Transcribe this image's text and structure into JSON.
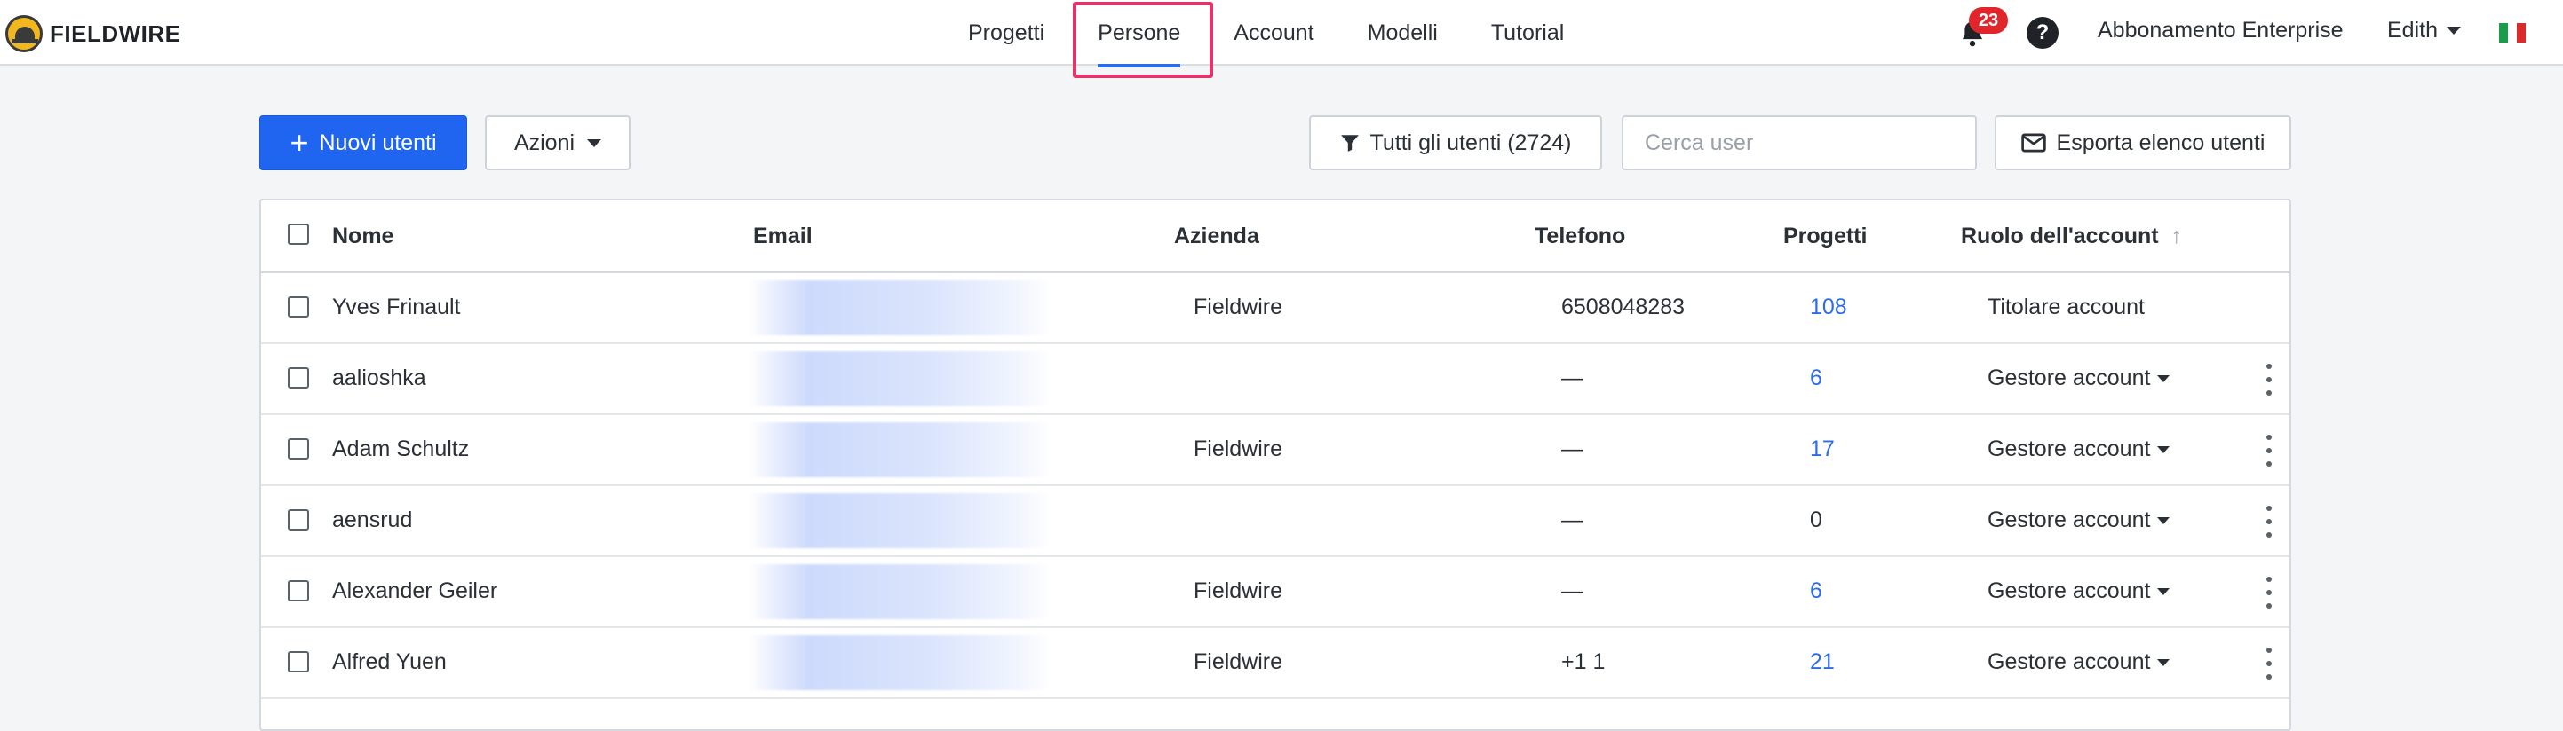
{
  "app": {
    "logo_text": "FIELDWIRE"
  },
  "nav": {
    "tabs": [
      {
        "label": "Progetti"
      },
      {
        "label": "Persone"
      },
      {
        "label": "Account"
      },
      {
        "label": "Modelli"
      },
      {
        "label": "Tutorial"
      }
    ],
    "active_tab": "Persone",
    "notification_count": "23",
    "help_label": "?",
    "plan_label": "Abbonamento Enterprise",
    "user_name": "Edith"
  },
  "toolbar": {
    "new_users_label": "Nuovi utenti",
    "actions_label": "Azioni",
    "filter_label": "Tutti gli utenti (2724)",
    "search_placeholder": "Cerca user",
    "export_label": "Esporta elenco utenti"
  },
  "table": {
    "columns": {
      "name": "Nome",
      "email": "Email",
      "company": "Azienda",
      "phone": "Telefono",
      "projects": "Progetti",
      "role": "Ruolo dell'account"
    },
    "rows": [
      {
        "name": "Yves Frinault",
        "company": "Fieldwire",
        "phone": "6508048283",
        "projects": "108",
        "role": "Titolare account"
      },
      {
        "name": "aalioshka",
        "company": "",
        "phone": "—",
        "projects": "6",
        "role": "Gestore account"
      },
      {
        "name": "Adam Schultz",
        "company": "Fieldwire",
        "phone": "—",
        "projects": "17",
        "role": "Gestore account"
      },
      {
        "name": "aensrud",
        "company": "",
        "phone": "—",
        "projects": "0",
        "role": "Gestore account"
      },
      {
        "name": "Alexander Geiler",
        "company": "Fieldwire",
        "phone": "—",
        "projects": "6",
        "role": "Gestore account"
      },
      {
        "name": "Alfred Yuen",
        "company": "Fieldwire",
        "phone": "+1 1",
        "projects": "21",
        "role": "Gestore account"
      }
    ]
  },
  "colors": {
    "accent": "#1f65f0",
    "link": "#2e6ce6",
    "highlight": "#e5336c",
    "badge": "#e0262b"
  }
}
